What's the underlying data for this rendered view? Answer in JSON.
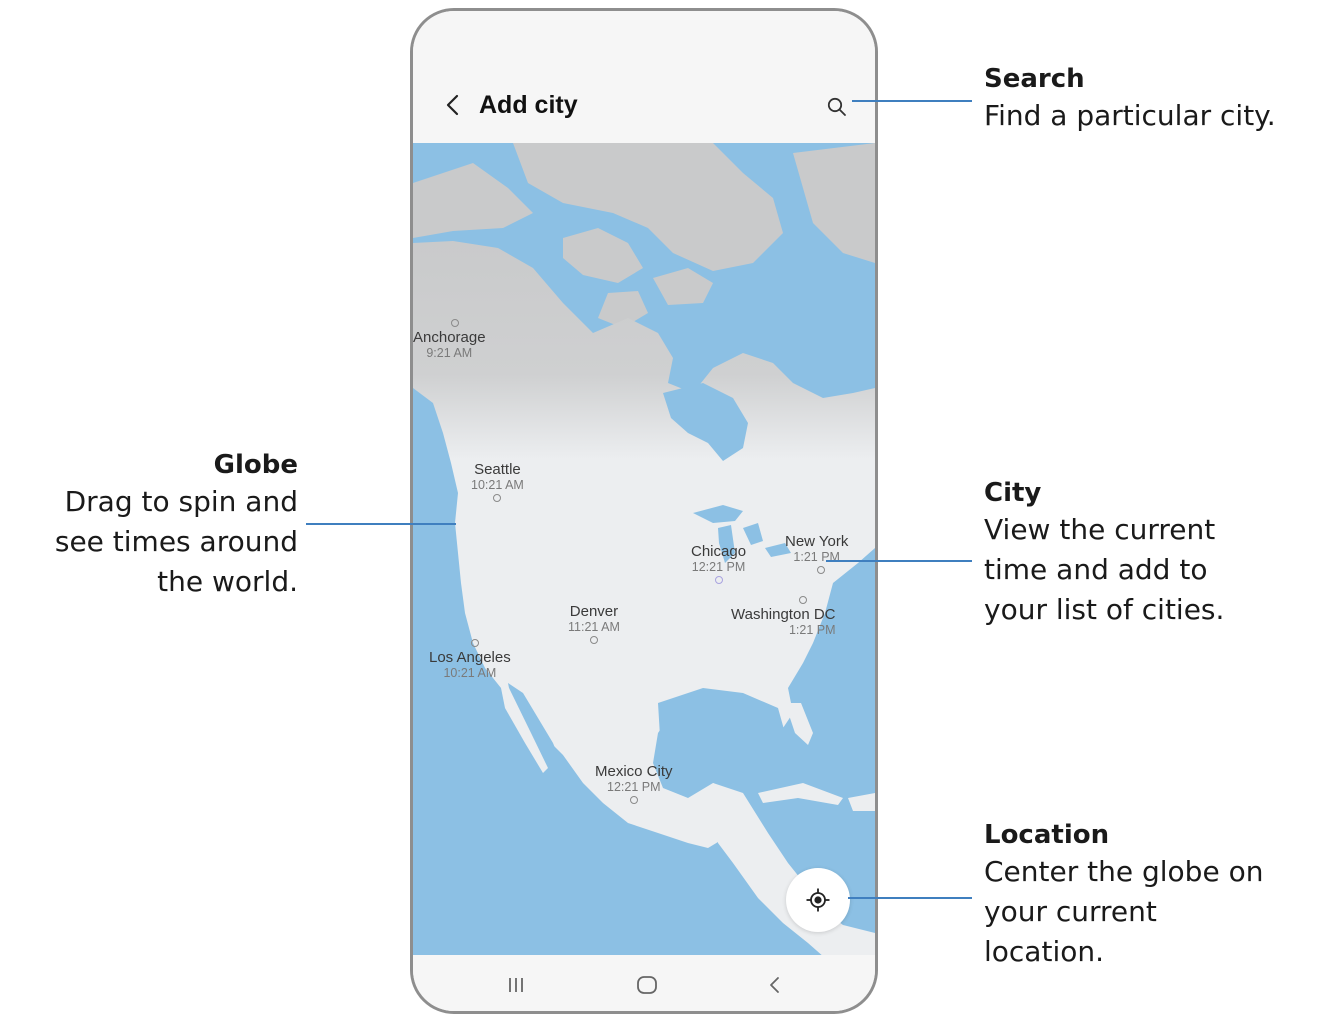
{
  "header": {
    "title": "Add city"
  },
  "cities": [
    {
      "name": "Anchorage",
      "time": "9:21 AM"
    },
    {
      "name": "Seattle",
      "time": "10:21 AM"
    },
    {
      "name": "Chicago",
      "time": "12:21 PM"
    },
    {
      "name": "New York",
      "time": "1:21 PM"
    },
    {
      "name": "Denver",
      "time": "11:21 AM"
    },
    {
      "name": "Washington DC",
      "time": "1:21 PM"
    },
    {
      "name": "Los Angeles",
      "time": "10:21 AM"
    },
    {
      "name": "Mexico City",
      "time": "12:21 PM"
    }
  ],
  "callouts": {
    "search": {
      "title": "Search",
      "desc": "Find a particular city."
    },
    "globe": {
      "title": "Globe",
      "desc_lines": [
        "Drag to spin and",
        "see times around",
        "the world."
      ]
    },
    "city": {
      "title": "City",
      "desc_lines": [
        "View the current",
        "time and add to",
        "your list of cities."
      ]
    },
    "location": {
      "title": "Location",
      "desc_lines": [
        "Center the globe on",
        "your current",
        "location."
      ]
    }
  },
  "icons": {
    "back": "chevron-left-icon",
    "search": "search-icon",
    "location": "location-target-icon",
    "nav_recents": "recents-icon",
    "nav_home": "home-icon",
    "nav_back": "back-icon"
  },
  "colors": {
    "ocean": "#8cc0e4",
    "land": "#eceef0",
    "polar_land": "#c9cacb",
    "accent": "#3f7fbf"
  }
}
